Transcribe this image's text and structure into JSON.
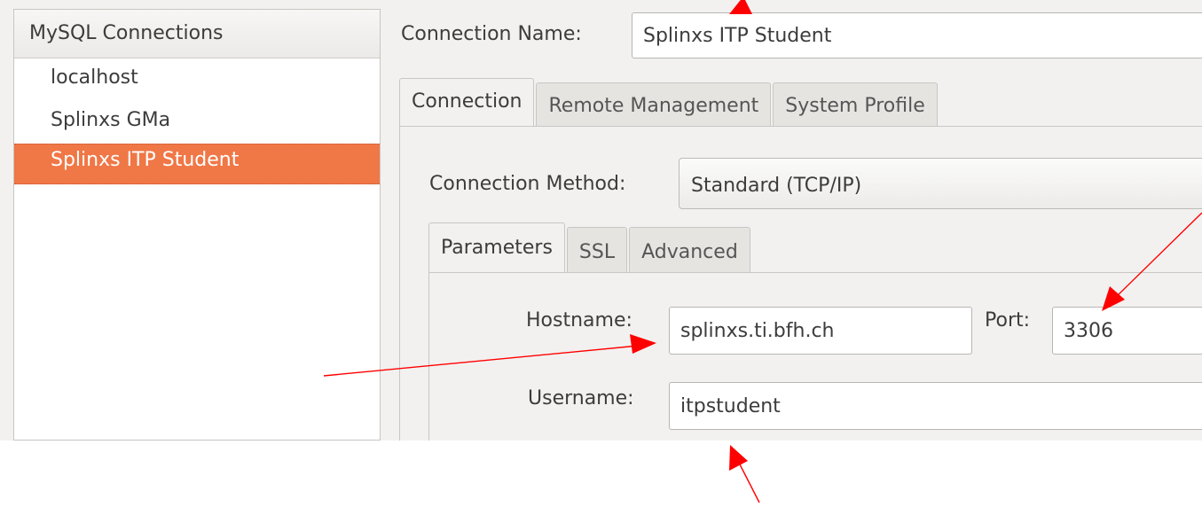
{
  "connections": {
    "header": "MySQL Connections",
    "items": [
      {
        "label": "localhost"
      },
      {
        "label": "Splinxs GMa"
      },
      {
        "label": "Splinxs ITP Student",
        "selected": true
      }
    ]
  },
  "connection_name": {
    "label": "Connection Name:",
    "value": "Splinxs ITP Student"
  },
  "outer_tabs": [
    {
      "label": "Connection",
      "active": true
    },
    {
      "label": "Remote Management",
      "active": false
    },
    {
      "label": "System Profile",
      "active": false
    }
  ],
  "connection_method": {
    "label": "Connection Method:",
    "value": "Standard (TCP/IP)"
  },
  "inner_tabs": [
    {
      "label": "Parameters",
      "active": true
    },
    {
      "label": "SSL",
      "active": false
    },
    {
      "label": "Advanced",
      "active": false
    }
  ],
  "parameters": {
    "hostname_label": "Hostname:",
    "hostname_value": "splinxs.ti.bfh.ch",
    "port_label": "Port:",
    "port_value": "3306",
    "username_label": "Username:",
    "username_value": "itpstudent"
  },
  "colors": {
    "selection": "#f07746",
    "annotation_arrow": "#ff0000"
  }
}
